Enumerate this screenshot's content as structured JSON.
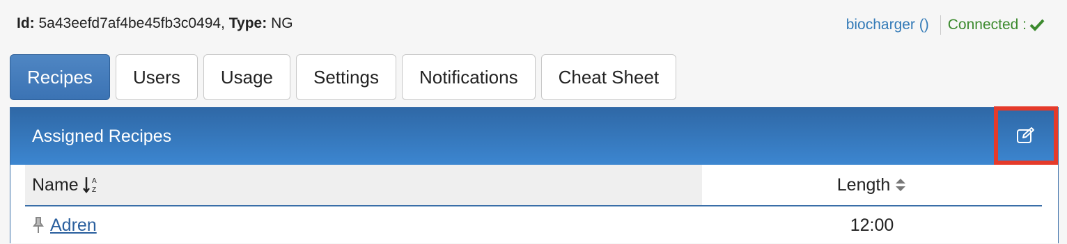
{
  "header": {
    "id_label": "Id:",
    "id_value": "5a43eefd7af4be45fb3c0494,",
    "type_label": "Type:",
    "type_value": "NG",
    "device_link": "biocharger ()",
    "status_text": "Connected :",
    "status_color": "#3c8a2e"
  },
  "tabs": [
    {
      "label": "Recipes",
      "active": true
    },
    {
      "label": "Users"
    },
    {
      "label": "Usage"
    },
    {
      "label": "Settings"
    },
    {
      "label": "Notifications"
    },
    {
      "label": "Cheat Sheet"
    }
  ],
  "panel": {
    "title": "Assigned Recipes",
    "edit_icon": "edit-icon",
    "columns": {
      "name": "Name",
      "length": "Length"
    },
    "rows": [
      {
        "name": "Adren",
        "length": "12:00",
        "icon": "pin-icon"
      }
    ]
  },
  "colors": {
    "accent": "#3b73b4",
    "highlight": "#e53a2a"
  }
}
